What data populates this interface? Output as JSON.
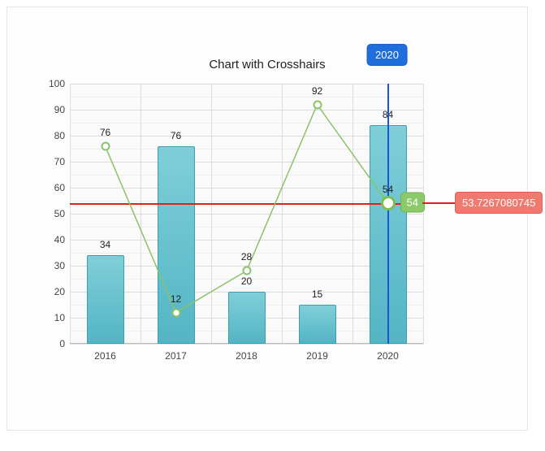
{
  "chart_data": {
    "type": "bar",
    "title": "Chart with Crosshairs",
    "categories": [
      "2016",
      "2017",
      "2018",
      "2019",
      "2020"
    ],
    "series": [
      {
        "name": "bars",
        "type": "bar",
        "values": [
          34,
          76,
          20,
          15,
          84
        ]
      },
      {
        "name": "line",
        "type": "line",
        "values": [
          76,
          12,
          28,
          92,
          54
        ]
      }
    ],
    "ylim": [
      0,
      100
    ],
    "yticks": [
      0,
      10,
      20,
      30,
      40,
      50,
      60,
      70,
      80,
      90,
      100
    ],
    "crosshair": {
      "x_index": 4,
      "x_label": "2020",
      "y": 53.7267080745,
      "y_label": "53.7267080745",
      "datapoint_label": "54"
    }
  },
  "labels": {
    "bar": [
      "34",
      "76",
      "20",
      "15",
      "84"
    ],
    "line": [
      "76",
      "12",
      "28",
      "92",
      "54"
    ]
  }
}
